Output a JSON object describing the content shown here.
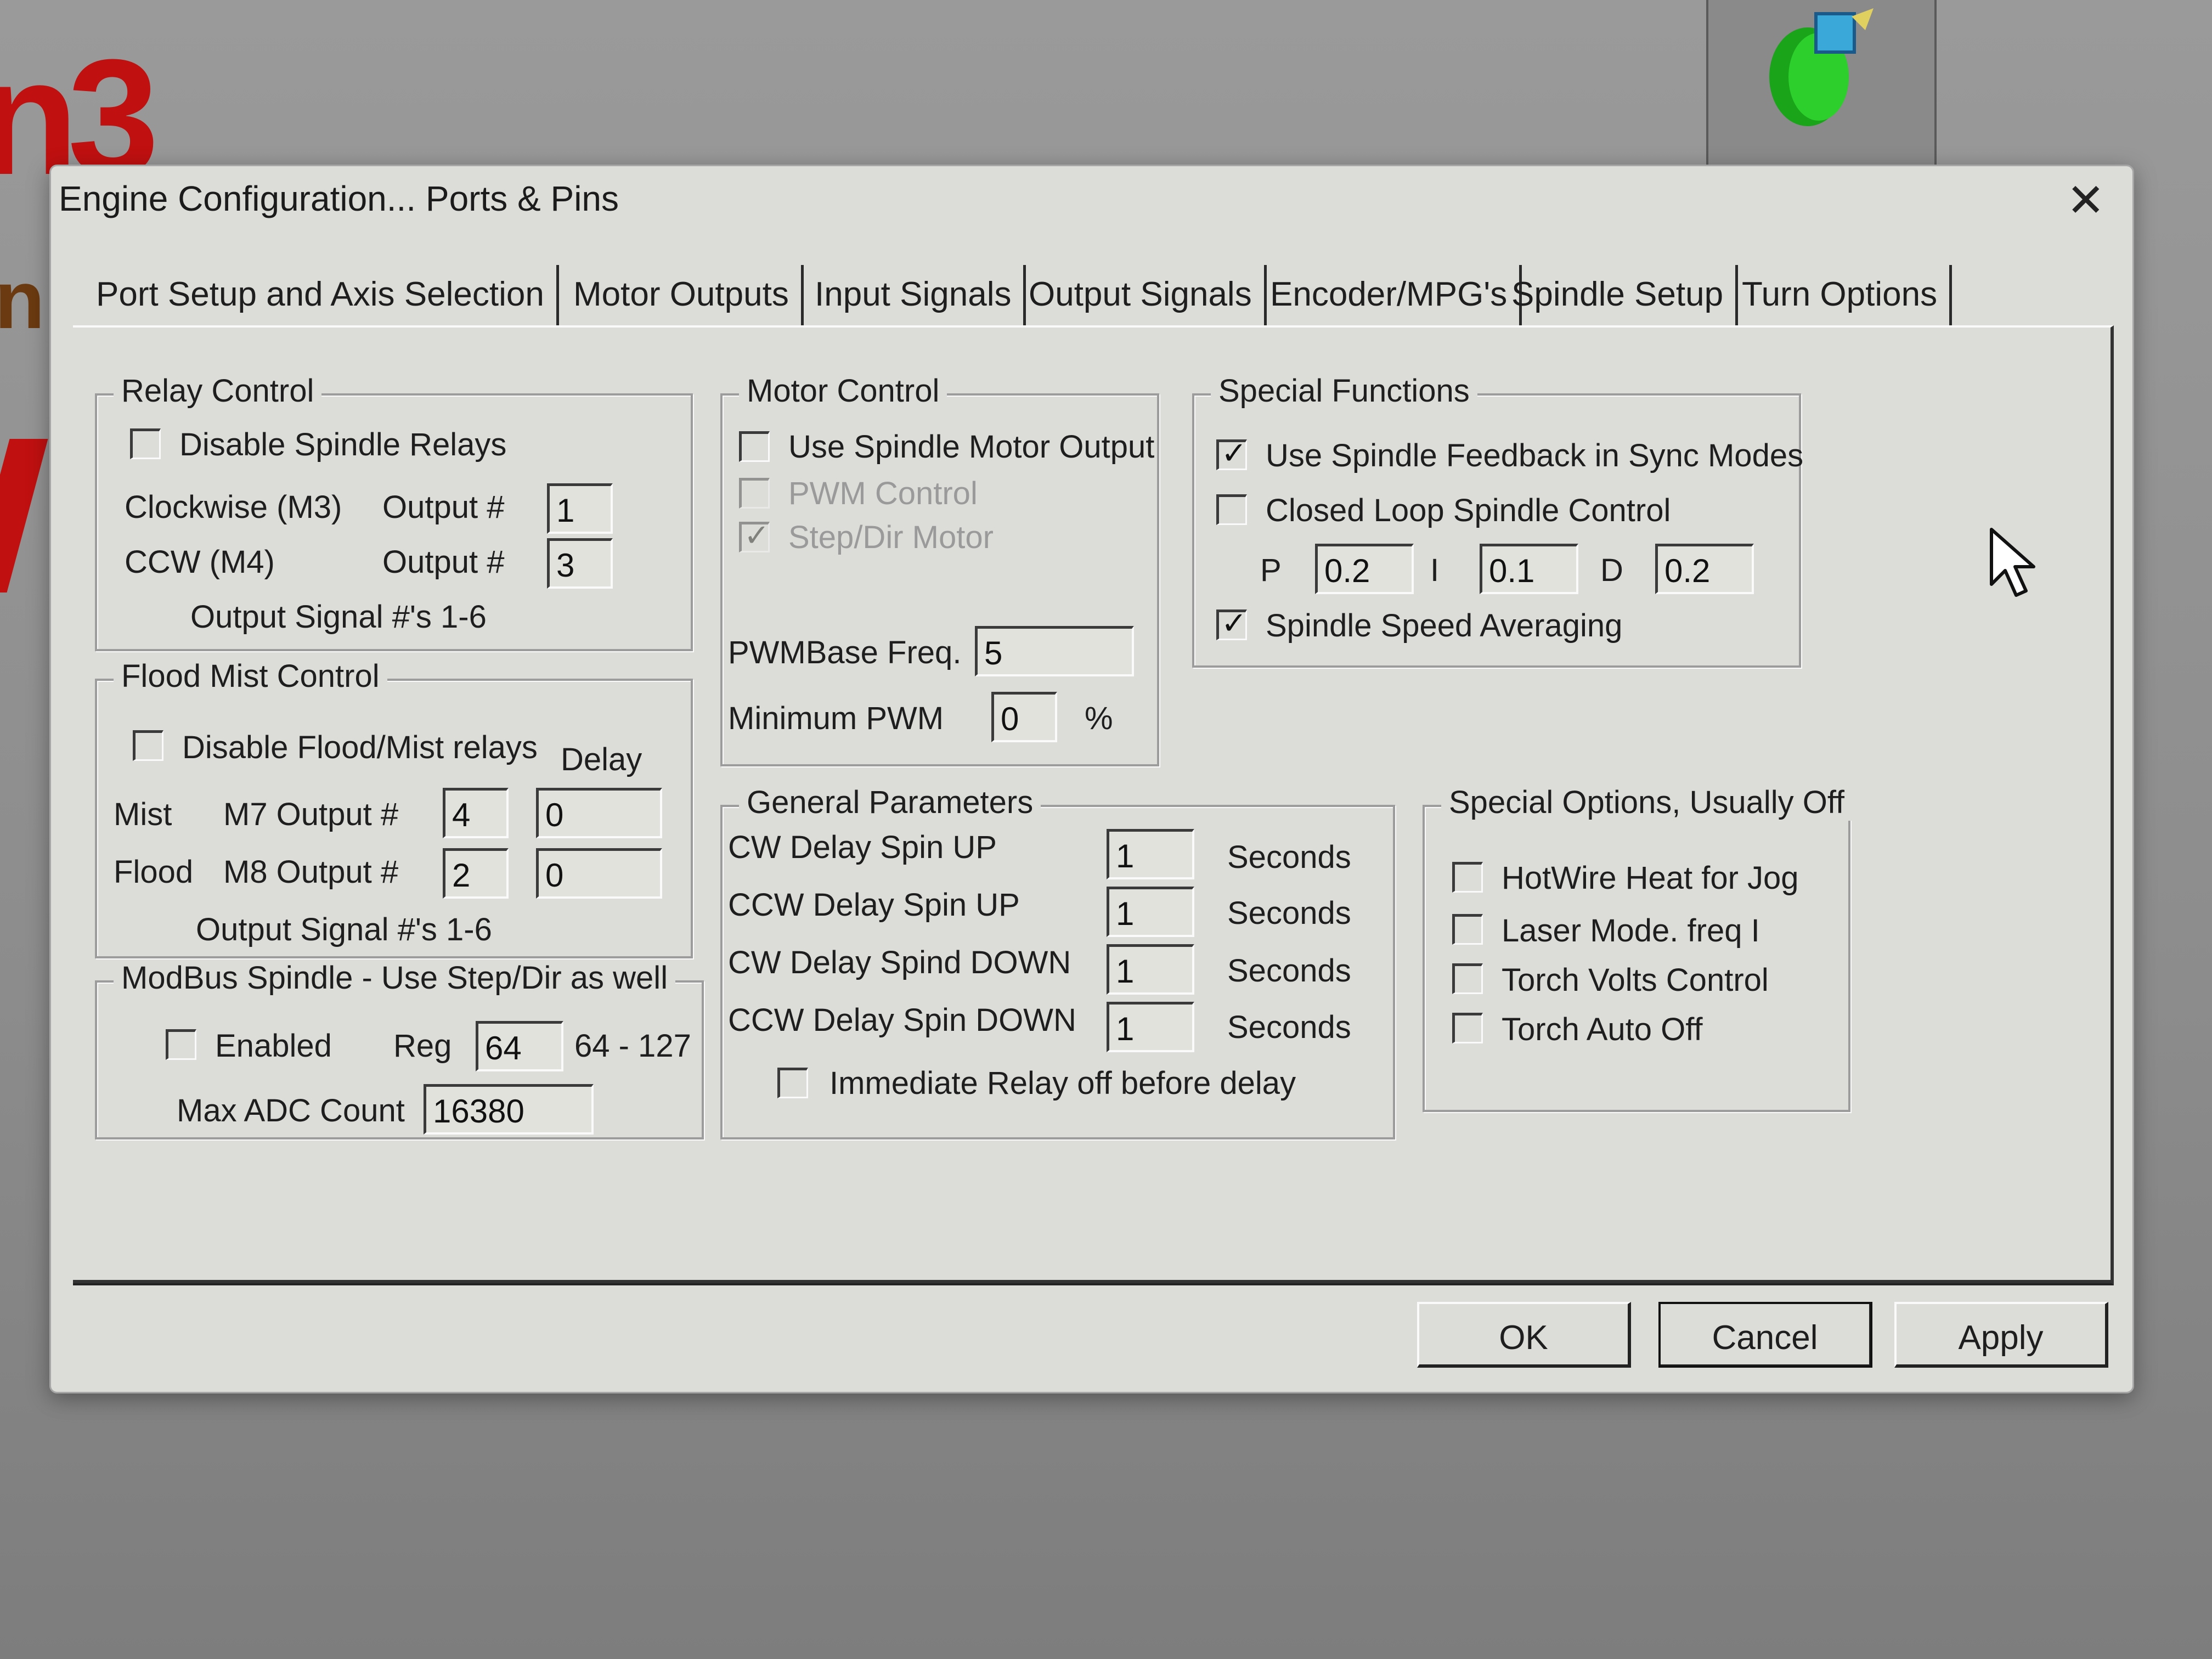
{
  "background": {
    "logo_text": "n3",
    "letter": "n"
  },
  "dialog": {
    "title": "Engine Configuration... Ports & Pins",
    "close_glyph": "✕"
  },
  "tabs": [
    {
      "label": "Port Setup and Axis Selection"
    },
    {
      "label": "Motor Outputs"
    },
    {
      "label": "Input Signals"
    },
    {
      "label": "Output Signals"
    },
    {
      "label": "Encoder/MPG's"
    },
    {
      "label": "Spindle Setup",
      "active": true
    },
    {
      "label": "Turn Options"
    }
  ],
  "relay_control": {
    "title": "Relay Control",
    "disable_label": "Disable Spindle Relays",
    "disable_checked": false,
    "cw_label": "Clockwise (M3)",
    "ccw_label": "CCW (M4)",
    "output_label": "Output #",
    "cw_output": "1",
    "ccw_output": "3",
    "footer": "Output Signal #'s 1-6"
  },
  "flood_mist": {
    "title": "Flood Mist Control",
    "disable_label": "Disable Flood/Mist relays",
    "disable_checked": false,
    "delay_label": "Delay",
    "mist_label": "Mist",
    "mist_output_label": "M7 Output #",
    "mist_output": "4",
    "mist_delay": "0",
    "flood_label": "Flood",
    "flood_output_label": "M8 Output #",
    "flood_output": "2",
    "flood_delay": "0",
    "footer": "Output Signal #'s 1-6"
  },
  "modbus": {
    "title": "ModBus Spindle - Use Step/Dir as well",
    "enabled_label": "Enabled",
    "enabled_checked": false,
    "reg_label": "Reg",
    "reg_value": "64",
    "reg_range": "64 - 127",
    "max_adc_label": "Max ADC Count",
    "max_adc_value": "16380"
  },
  "motor_control": {
    "title": "Motor Control",
    "use_spindle_label": "Use Spindle Motor Output",
    "use_spindle_checked": false,
    "pwm_label": "PWM Control",
    "pwm_checked": false,
    "stepdir_label": "Step/Dir Motor",
    "stepdir_checked": true,
    "pwm_base_label": "PWMBase Freq.",
    "pwm_base_value": "5",
    "min_pwm_label": "Minimum PWM",
    "min_pwm_value": "0",
    "min_pwm_unit": "%"
  },
  "special_functions": {
    "title": "Special Functions",
    "feedback_label": "Use Spindle Feedback in Sync Modes",
    "feedback_checked": true,
    "closed_loop_label": "Closed Loop Spindle Control",
    "closed_loop_checked": false,
    "p_label": "P",
    "p_value": "0.2",
    "i_label": "I",
    "i_value": "0.1",
    "d_label": "D",
    "d_value": "0.2",
    "averaging_label": "Spindle Speed Averaging",
    "averaging_checked": true
  },
  "general_parameters": {
    "title": "General Parameters",
    "rows": [
      {
        "label": "CW Delay Spin UP",
        "value": "1",
        "unit": "Seconds"
      },
      {
        "label": "CCW Delay Spin UP",
        "value": "1",
        "unit": "Seconds"
      },
      {
        "label": "CW Delay Spind DOWN",
        "value": "1",
        "unit": "Seconds"
      },
      {
        "label": "CCW Delay Spin DOWN",
        "value": "1",
        "unit": "Seconds"
      }
    ],
    "immediate_label": "Immediate Relay off before delay",
    "immediate_checked": false
  },
  "special_options": {
    "title": "Special Options, Usually Off",
    "items": [
      {
        "label": "HotWire Heat for Jog",
        "checked": false
      },
      {
        "label": "Laser Mode. freq I",
        "checked": false
      },
      {
        "label": "Torch Volts Control",
        "checked": false
      },
      {
        "label": "Torch Auto Off",
        "checked": false
      }
    ]
  },
  "buttons": {
    "ok": "OK",
    "cancel": "Cancel",
    "apply": "Apply"
  }
}
